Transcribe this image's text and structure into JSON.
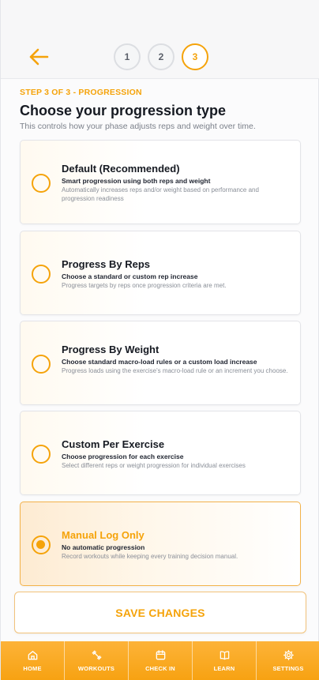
{
  "header": {
    "steps": [
      "1",
      "2",
      "3"
    ],
    "active_step": "3"
  },
  "intro": {
    "eyebrow": "STEP 3 OF 3 - PROGRESSION",
    "title": "Choose your progression type",
    "subtitle": "This controls how your phase adjusts reps and weight over time."
  },
  "options": [
    {
      "title": "Default (Recommended)",
      "subtitle": "Smart progression using both reps and weight",
      "description": "Automatically increases reps and/or weight based on performance and progression readiness",
      "selected": false
    },
    {
      "title": "Progress By Reps",
      "subtitle": "Choose a standard or custom rep increase",
      "description": "Progress targets by reps once progression criteria are met.",
      "selected": false
    },
    {
      "title": "Progress By Weight",
      "subtitle": "Choose standard macro-load rules or a custom load increase",
      "description": "Progress loads using the exercise's macro-load rule or an increment you choose.",
      "selected": false
    },
    {
      "title": "Custom Per Exercise",
      "subtitle": "Choose progression for each exercise",
      "description": "Select different reps or weight progression for individual exercises",
      "selected": false
    },
    {
      "title": "Manual Log Only",
      "subtitle": "No automatic progression",
      "description": "Record workouts while keeping every training decision manual.",
      "selected": true
    }
  ],
  "save_label": "SAVE CHANGES",
  "tabbar": [
    {
      "label": "HOME",
      "icon": "home-icon"
    },
    {
      "label": "WORKOUTS",
      "icon": "dumbbell-icon"
    },
    {
      "label": "CHECK IN",
      "icon": "calendar-icon"
    },
    {
      "label": "LEARN",
      "icon": "book-icon"
    },
    {
      "label": "SETTINGS",
      "icon": "gear-icon"
    }
  ],
  "colors": {
    "accent": "#f5a30a",
    "tabbar": "#f9a91f",
    "text": "#161a22",
    "muted": "#8a8f98"
  }
}
